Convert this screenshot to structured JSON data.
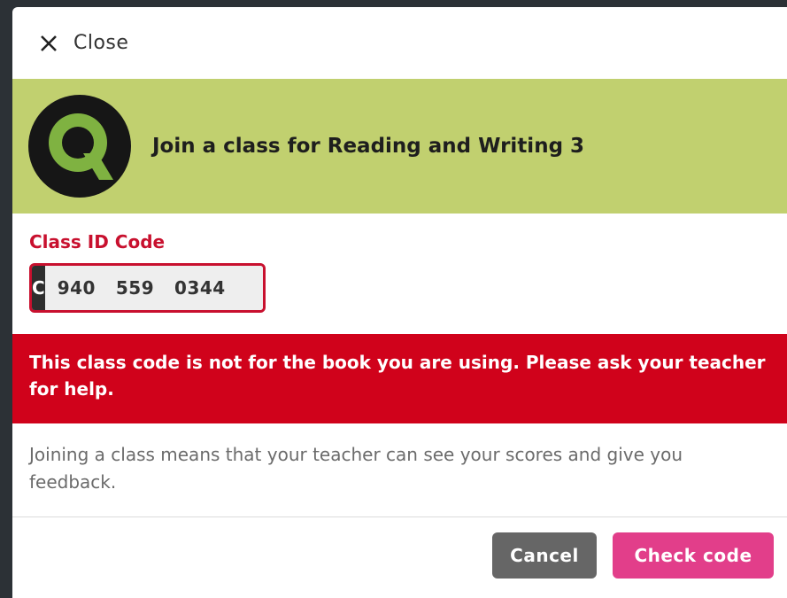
{
  "close": {
    "label": "Close",
    "icon": "close-icon"
  },
  "header": {
    "title": "Join a class for Reading and Writing 3",
    "logo_icon": "q-logo-icon",
    "background": "#c1d06f"
  },
  "class_code": {
    "label": "Class ID Code",
    "prefix": "C",
    "value": "940  559  0344"
  },
  "error": {
    "message": "This class code is not for the book you are using. Please ask your teacher for help.",
    "color": "#d0021b"
  },
  "info": {
    "text": "Joining a class means that your teacher can see your scores and give you feedback."
  },
  "footer": {
    "cancel_label": "Cancel",
    "check_label": "Check code",
    "check_color": "#e23e8a"
  }
}
